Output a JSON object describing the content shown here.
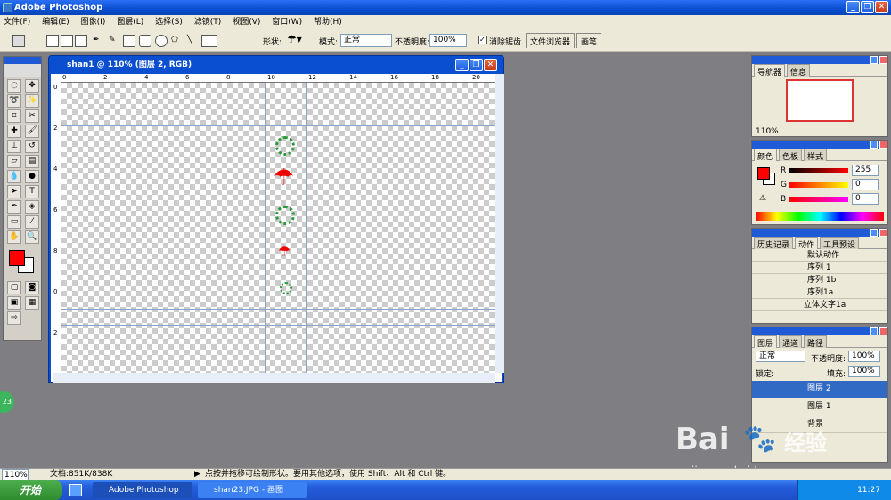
{
  "app": {
    "title": "Adobe Photoshop"
  },
  "menu": [
    "文件(F)",
    "编辑(E)",
    "图像(I)",
    "图层(L)",
    "选择(S)",
    "滤镜(T)",
    "视图(V)",
    "窗口(W)",
    "帮助(H)"
  ],
  "options": {
    "shape_label": "形状:",
    "mode_label": "模式:",
    "mode_value": "正常",
    "opacity_label": "不透明度:",
    "opacity_value": "100%",
    "antialias_label": "消除锯齿",
    "tab_file_browser": "文件浏览器",
    "tab_brush": "画笔"
  },
  "document": {
    "title": "shan1 @ 110% (图层 2, RGB)",
    "ruler_h": [
      "0",
      "2",
      "4",
      "6",
      "8",
      "10",
      "12",
      "14",
      "16",
      "18",
      "20"
    ],
    "ruler_v": [
      "0",
      "2",
      "4",
      "6",
      "8",
      "0",
      "2"
    ]
  },
  "navigator": {
    "tabs": [
      "导航器",
      "信息"
    ],
    "zoom": "110%"
  },
  "color": {
    "tabs": [
      "颜色",
      "色板",
      "样式"
    ],
    "r_label": "R",
    "g_label": "G",
    "b_label": "B",
    "r_value": "255",
    "g_value": "0",
    "b_value": "0",
    "fg": "#ff0000",
    "bg": "#ffffff"
  },
  "actions": {
    "tabs": [
      "历史记录",
      "动作",
      "工具预设"
    ],
    "items": [
      "默认动作",
      "序列 1",
      "序列 1b",
      "序列1a",
      "立体文字1a"
    ]
  },
  "layers": {
    "tabs": [
      "图层",
      "通道",
      "路径"
    ],
    "blend": "正常",
    "opacity_label": "不透明度:",
    "opacity_value": "100%",
    "lock_label": "锁定:",
    "fill_label": "填充:",
    "fill_value": "100%",
    "items": [
      "图层 2",
      "图层 1",
      "背景"
    ]
  },
  "status": {
    "zoom": "110%",
    "doc": "文档:851K/838K",
    "hint": "点按并拖移可绘制形状。要用其他选项，使用 Shift、Alt 和 Ctrl 键。"
  },
  "taskbar": {
    "start": "开始",
    "task1": "Adobe Photoshop",
    "task2": "shan23.JPG - 画图",
    "time": "11:27"
  },
  "watermark": {
    "brand": "Bai",
    "brand2": "经验",
    "url": "jingyan.baidu.com"
  },
  "side_badge": "23"
}
